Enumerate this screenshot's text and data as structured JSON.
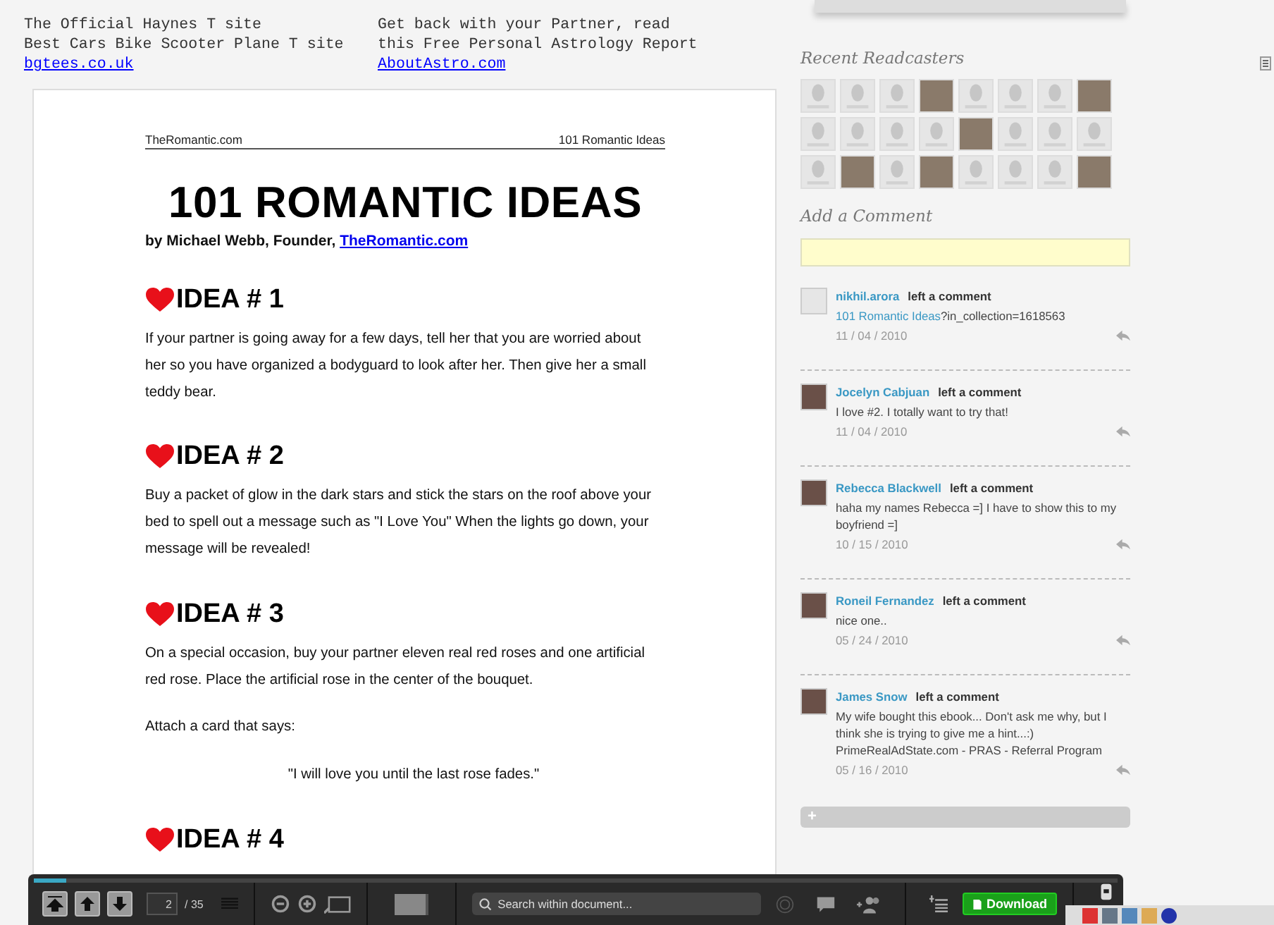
{
  "ad": {
    "columns": [
      {
        "lines": [
          "The Official Haynes T site",
          "Best Cars Bike Scooter Plane T site"
        ],
        "link": "bgtees.co.uk"
      },
      {
        "lines": [
          "Get back with your Partner, read",
          "this Free Personal Astrology Report"
        ],
        "link": "AboutAstro.com"
      }
    ]
  },
  "document": {
    "header_left": "TheRomantic.com",
    "header_right": "101 Romantic Ideas",
    "title": "101 ROMANTIC IDEAS",
    "byline": "by Michael Webb, Founder, ",
    "byline_link": "TheRomantic.com",
    "ideas": [
      {
        "heading": "IDEA # 1",
        "paragraphs": [
          {
            "kind": "body",
            "text": "If your partner is going away for a few days, tell her that you are worried about her so you have organized a bodyguard to look after her.  Then give her a small teddy bear."
          }
        ]
      },
      {
        "heading": "IDEA # 2",
        "paragraphs": [
          {
            "kind": "body",
            "text": "Buy a packet of glow in the dark stars and stick the stars on the roof above your bed to spell out a message such as \"I Love You\" When the lights go down, your message will be revealed!"
          }
        ]
      },
      {
        "heading": "IDEA # 3",
        "paragraphs": [
          {
            "kind": "body",
            "text": "On a special occasion, buy your partner eleven real red roses and one artificial red rose.  Place the artificial rose in the center of the bouquet."
          },
          {
            "kind": "body",
            "text": "Attach a card that says:"
          },
          {
            "kind": "quote",
            "text": "\"I will love you until the last rose fades.\""
          }
        ]
      },
      {
        "heading": "IDEA # 4"
      }
    ]
  },
  "sidebar": {
    "readcasters_title": "Recent Readcasters",
    "readcasters": [
      {
        "kind": "placeholder"
      },
      {
        "kind": "placeholder"
      },
      {
        "kind": "placeholder"
      },
      {
        "kind": "photo"
      },
      {
        "kind": "placeholder"
      },
      {
        "kind": "placeholder"
      },
      {
        "kind": "placeholder"
      },
      {
        "kind": "photo"
      },
      {
        "kind": "placeholder"
      },
      {
        "kind": "placeholder"
      },
      {
        "kind": "placeholder"
      },
      {
        "kind": "placeholder"
      },
      {
        "kind": "photo"
      },
      {
        "kind": "placeholder"
      },
      {
        "kind": "placeholder"
      },
      {
        "kind": "placeholder"
      },
      {
        "kind": "placeholder"
      },
      {
        "kind": "photo"
      },
      {
        "kind": "placeholder"
      },
      {
        "kind": "photo"
      },
      {
        "kind": "placeholder"
      },
      {
        "kind": "placeholder"
      },
      {
        "kind": "placeholder"
      },
      {
        "kind": "photo"
      }
    ],
    "add_comment_title": "Add a Comment",
    "comments": [
      {
        "avatar": {
          "kind": "placeholder"
        },
        "author": "nikhil.arora",
        "action": "left a comment",
        "link": "101 Romantic Ideas",
        "text": "?in_collection=1618563",
        "date": "11 / 04 / 2010"
      },
      {
        "avatar": {
          "kind": "photo"
        },
        "author": "Jocelyn Cabjuan",
        "action": "left a comment",
        "text": "I love #2. I totally want to try that!",
        "date": "11 / 04 / 2010"
      },
      {
        "avatar": {
          "kind": "photo"
        },
        "author": "Rebecca Blackwell",
        "action": "left a comment",
        "text": "haha my names Rebecca =] I have to show this to my boyfriend =]",
        "date": "10 / 15 / 2010"
      },
      {
        "avatar": {
          "kind": "photo"
        },
        "author": "Roneil Fernandez",
        "action": "left a comment",
        "text": "nice one..",
        "date": "05 / 24 / 2010"
      },
      {
        "avatar": {
          "kind": "photo"
        },
        "author": "James Snow",
        "action": "left a comment",
        "text": "My wife bought this ebook... Don't ask me why, but I think she is trying to give me a hint...:) PrimeRealAdState.com - PRAS - Referral Program",
        "date": "05 / 16 / 2010"
      }
    ],
    "more_label": "+"
  },
  "toolbar": {
    "progress": {
      "level": 0.03
    },
    "page": "2",
    "total": "/ 35",
    "search_placeholder": "Search within document...",
    "download": "Download"
  }
}
